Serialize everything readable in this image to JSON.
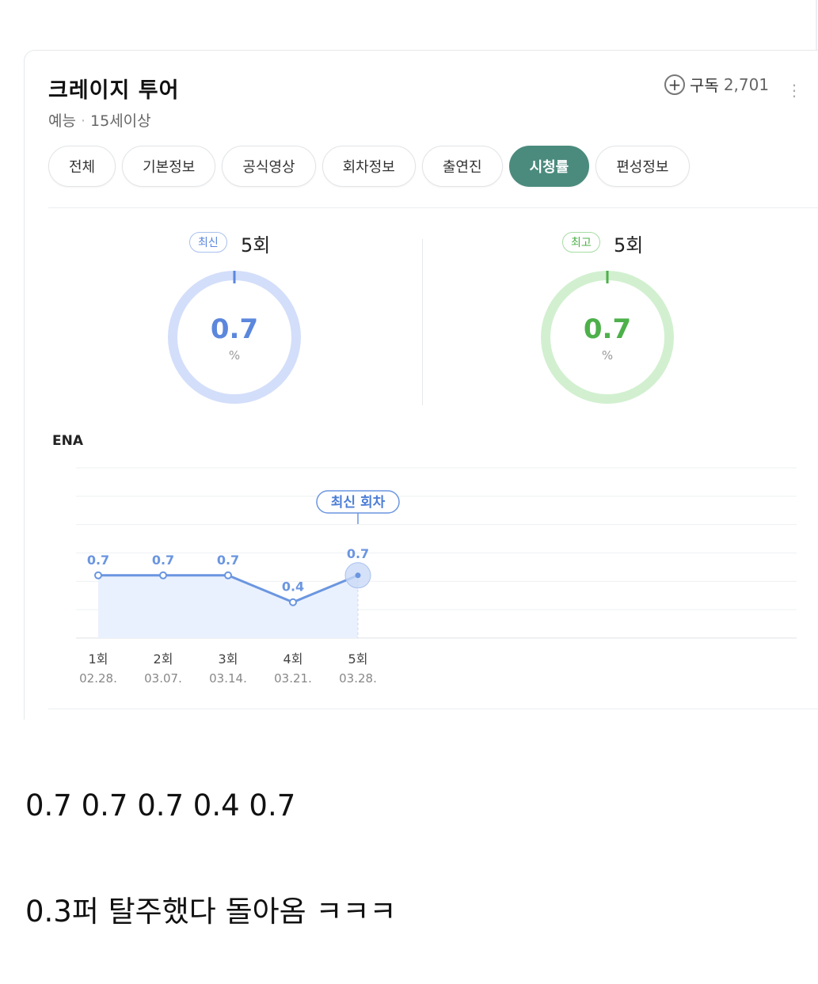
{
  "header": {
    "title": "크레이지 투어",
    "genre": "예능",
    "rating": "15세이상",
    "subscribe_label": "구독",
    "subscriber_count": "2,701",
    "more_icon": "kebab-icon"
  },
  "tabs": [
    {
      "label": "전체",
      "active": false
    },
    {
      "label": "기본정보",
      "active": false
    },
    {
      "label": "공식영상",
      "active": false
    },
    {
      "label": "회차정보",
      "active": false
    },
    {
      "label": "출연진",
      "active": false
    },
    {
      "label": "시청률",
      "active": true
    },
    {
      "label": "편성정보",
      "active": false
    }
  ],
  "latest": {
    "badge": "최신",
    "episode": "5회",
    "value": "0.7",
    "unit": "%",
    "color": "#5b87dc",
    "ring_color": "#d3defa"
  },
  "best": {
    "badge": "최고",
    "episode": "5회",
    "value": "0.7",
    "unit": "%",
    "color": "#4db04a",
    "ring_color": "#d2f0d0"
  },
  "colors": {
    "accent": "#4b8b7e",
    "line": "#6b96e0",
    "area": "#eaf1fe"
  },
  "chart_data": {
    "type": "area",
    "title": "ENA",
    "categories": [
      "1회",
      "2회",
      "3회",
      "4회",
      "5회"
    ],
    "dates": [
      "02.28.",
      "03.07.",
      "03.14.",
      "03.21.",
      "03.28."
    ],
    "values": [
      0.7,
      0.7,
      0.7,
      0.4,
      0.7
    ],
    "value_labels": [
      "0.7",
      "0.7",
      "0.7",
      "0.4",
      "0.7"
    ],
    "callout": "최신 회차",
    "ylim": [
      0,
      1.9
    ],
    "grid": true
  },
  "post": {
    "line1": "0.7 0.7 0.7 0.4 0.7",
    "line2": "0.3퍼 탈주했다 돌아옴 ㅋㅋㅋ"
  }
}
